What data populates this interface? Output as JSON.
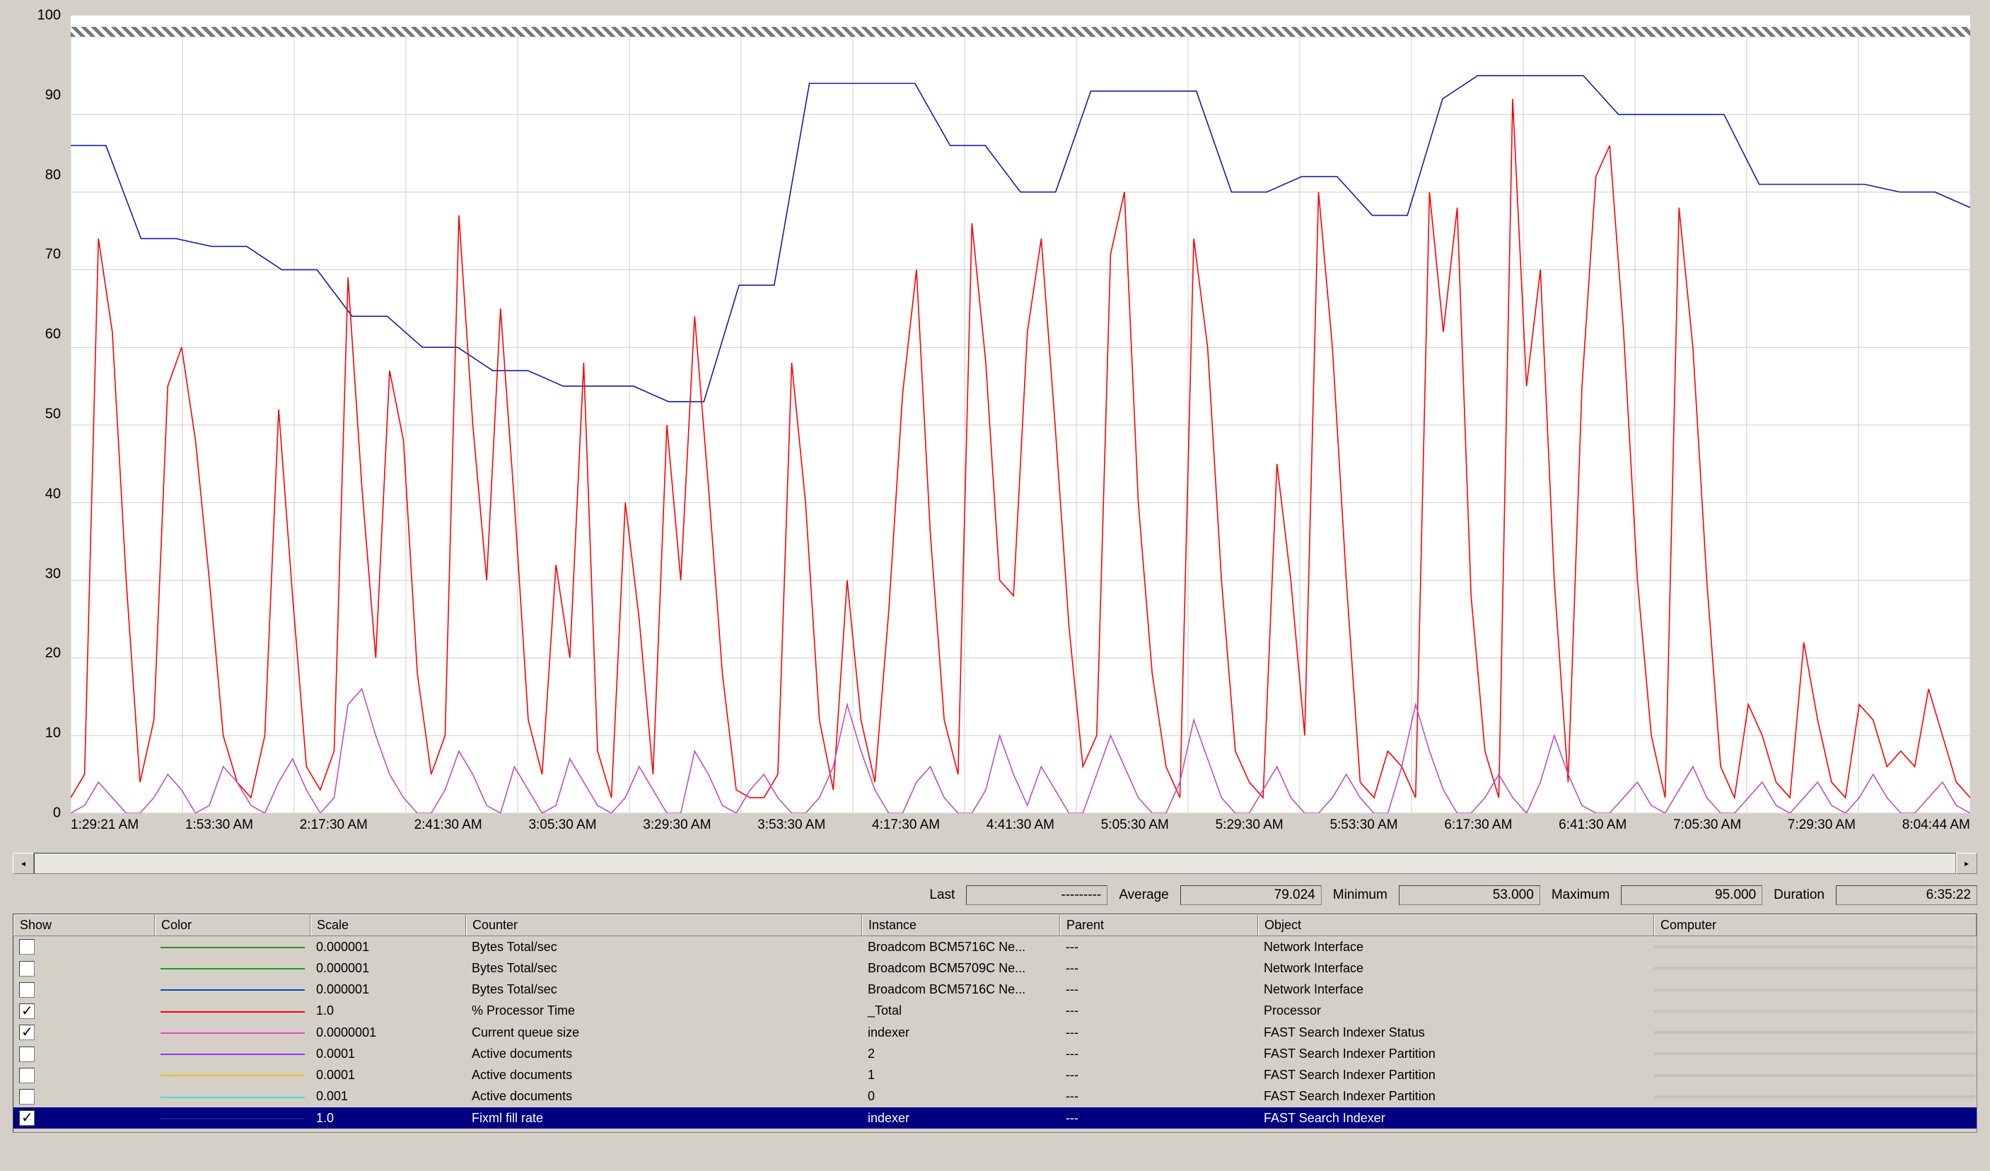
{
  "chart_data": {
    "type": "line",
    "ylim": [
      0,
      100
    ],
    "yticks": [
      0,
      10,
      20,
      30,
      40,
      50,
      60,
      70,
      80,
      90,
      100
    ],
    "xticks": [
      "1:29:21 AM",
      "1:53:30 AM",
      "2:17:30 AM",
      "2:41:30 AM",
      "3:05:30 AM",
      "3:29:30 AM",
      "3:53:30 AM",
      "4:17:30 AM",
      "4:41:30 AM",
      "5:05:30 AM",
      "5:29:30 AM",
      "5:53:30 AM",
      "6:17:30 AM",
      "6:41:30 AM",
      "7:05:30 AM",
      "7:29:30 AM",
      "8:04:44 AM"
    ],
    "x_span": 17,
    "series": [
      {
        "name": "Fixml fill rate",
        "color": "#1020a0",
        "values": [
          86,
          86,
          74,
          74,
          73,
          73,
          70,
          70,
          64,
          64,
          60,
          60,
          57,
          57,
          55,
          55,
          55,
          53,
          53,
          68,
          68,
          94,
          94,
          94,
          94,
          86,
          86,
          80,
          80,
          93,
          93,
          93,
          93,
          80,
          80,
          82,
          82,
          77,
          77,
          92,
          95,
          95,
          95,
          95,
          90,
          90,
          90,
          90,
          81,
          81,
          81,
          81,
          80,
          80,
          78
        ]
      },
      {
        "name": "% Processor Time",
        "color": "#ff0000",
        "values": [
          2,
          5,
          74,
          62,
          30,
          4,
          12,
          55,
          60,
          48,
          30,
          10,
          4,
          2,
          10,
          52,
          28,
          6,
          3,
          8,
          69,
          42,
          20,
          57,
          48,
          18,
          5,
          10,
          77,
          50,
          30,
          65,
          40,
          12,
          5,
          32,
          20,
          58,
          8,
          2,
          40,
          25,
          5,
          50,
          30,
          64,
          42,
          18,
          3,
          2,
          2,
          5,
          58,
          40,
          12,
          3,
          30,
          12,
          4,
          26,
          54,
          70,
          36,
          12,
          5,
          76,
          58,
          30,
          28,
          62,
          74,
          50,
          24,
          6,
          10,
          72,
          80,
          40,
          18,
          6,
          2,
          74,
          60,
          30,
          8,
          4,
          2,
          45,
          30,
          10,
          80,
          60,
          30,
          4,
          2,
          8,
          6,
          2,
          80,
          62,
          78,
          28,
          8,
          2,
          92,
          55,
          70,
          30,
          4,
          55,
          82,
          86,
          62,
          30,
          10,
          2,
          78,
          60,
          30,
          6,
          2,
          14,
          10,
          4,
          2,
          22,
          12,
          4,
          2,
          14,
          12,
          6,
          8,
          6,
          16,
          10,
          4,
          2
        ]
      },
      {
        "name": "Active documents (2)",
        "color": "#c050c0",
        "values": [
          0,
          1,
          4,
          2,
          0,
          0,
          2,
          5,
          3,
          0,
          1,
          6,
          4,
          1,
          0,
          4,
          7,
          3,
          0,
          2,
          14,
          16,
          10,
          5,
          2,
          0,
          0,
          3,
          8,
          5,
          1,
          0,
          6,
          3,
          0,
          1,
          7,
          4,
          1,
          0,
          2,
          6,
          3,
          0,
          0,
          8,
          5,
          1,
          0,
          3,
          5,
          2,
          0,
          0,
          2,
          6,
          14,
          8,
          3,
          0,
          0,
          4,
          6,
          2,
          0,
          0,
          3,
          10,
          5,
          1,
          6,
          3,
          0,
          0,
          5,
          10,
          6,
          2,
          0,
          0,
          4,
          12,
          7,
          2,
          0,
          0,
          3,
          6,
          2,
          0,
          0,
          2,
          5,
          2,
          0,
          0,
          6,
          14,
          8,
          3,
          0,
          0,
          2,
          5,
          2,
          0,
          4,
          10,
          5,
          1,
          0,
          0,
          2,
          4,
          1,
          0,
          3,
          6,
          2,
          0,
          0,
          2,
          4,
          1,
          0,
          2,
          4,
          1,
          0,
          2,
          5,
          2,
          0,
          0,
          2,
          4,
          1,
          0
        ]
      }
    ]
  },
  "stats": {
    "last_label": "Last",
    "last_value": "---------",
    "avg_label": "Average",
    "avg_value": "79.024",
    "min_label": "Minimum",
    "min_value": "53.000",
    "max_label": "Maximum",
    "max_value": "95.000",
    "dur_label": "Duration",
    "dur_value": "6:35:22"
  },
  "legend": {
    "headers": {
      "show": "Show",
      "color": "Color",
      "scale": "Scale",
      "counter": "Counter",
      "instance": "Instance",
      "parent": "Parent",
      "object": "Object",
      "computer": "Computer"
    },
    "rows": [
      {
        "checked": false,
        "color": "#2e8b2e",
        "scale": "0.000001",
        "counter": "Bytes Total/sec",
        "instance": "Broadcom BCM5716C Ne...",
        "parent": "---",
        "object": "Network Interface",
        "computer": ""
      },
      {
        "checked": false,
        "color": "#1a9e1a",
        "scale": "0.000001",
        "counter": "Bytes Total/sec",
        "instance": "Broadcom BCM5709C Ne...",
        "parent": "---",
        "object": "Network Interface",
        "computer": ""
      },
      {
        "checked": false,
        "color": "#1040c0",
        "scale": "0.000001",
        "counter": "Bytes Total/sec",
        "instance": "Broadcom BCM5716C Ne...",
        "parent": "---",
        "object": "Network Interface",
        "computer": ""
      },
      {
        "checked": true,
        "color": "#ff0000",
        "scale": "1.0",
        "counter": "% Processor Time",
        "instance": "_Total",
        "parent": "---",
        "object": "Processor",
        "computer": ""
      },
      {
        "checked": true,
        "color": "#e846c4",
        "scale": "0.0000001",
        "counter": "Current queue size",
        "instance": "indexer",
        "parent": "---",
        "object": "FAST Search Indexer Status",
        "computer": ""
      },
      {
        "checked": false,
        "color": "#9b30ff",
        "scale": "0.0001",
        "counter": "Active documents",
        "instance": "2",
        "parent": "---",
        "object": "FAST Search Indexer Partition",
        "computer": ""
      },
      {
        "checked": false,
        "color": "#f0c000",
        "scale": "0.0001",
        "counter": "Active documents",
        "instance": "1",
        "parent": "---",
        "object": "FAST Search Indexer Partition",
        "computer": ""
      },
      {
        "checked": false,
        "color": "#40e0d0",
        "scale": "0.001",
        "counter": "Active documents",
        "instance": "0",
        "parent": "---",
        "object": "FAST Search Indexer Partition",
        "computer": ""
      },
      {
        "checked": true,
        "color": "#1020a0",
        "scale": "1.0",
        "counter": "Fixml fill rate",
        "instance": "indexer",
        "parent": "---",
        "object": "FAST Search Indexer",
        "computer": "",
        "selected": true
      }
    ]
  }
}
